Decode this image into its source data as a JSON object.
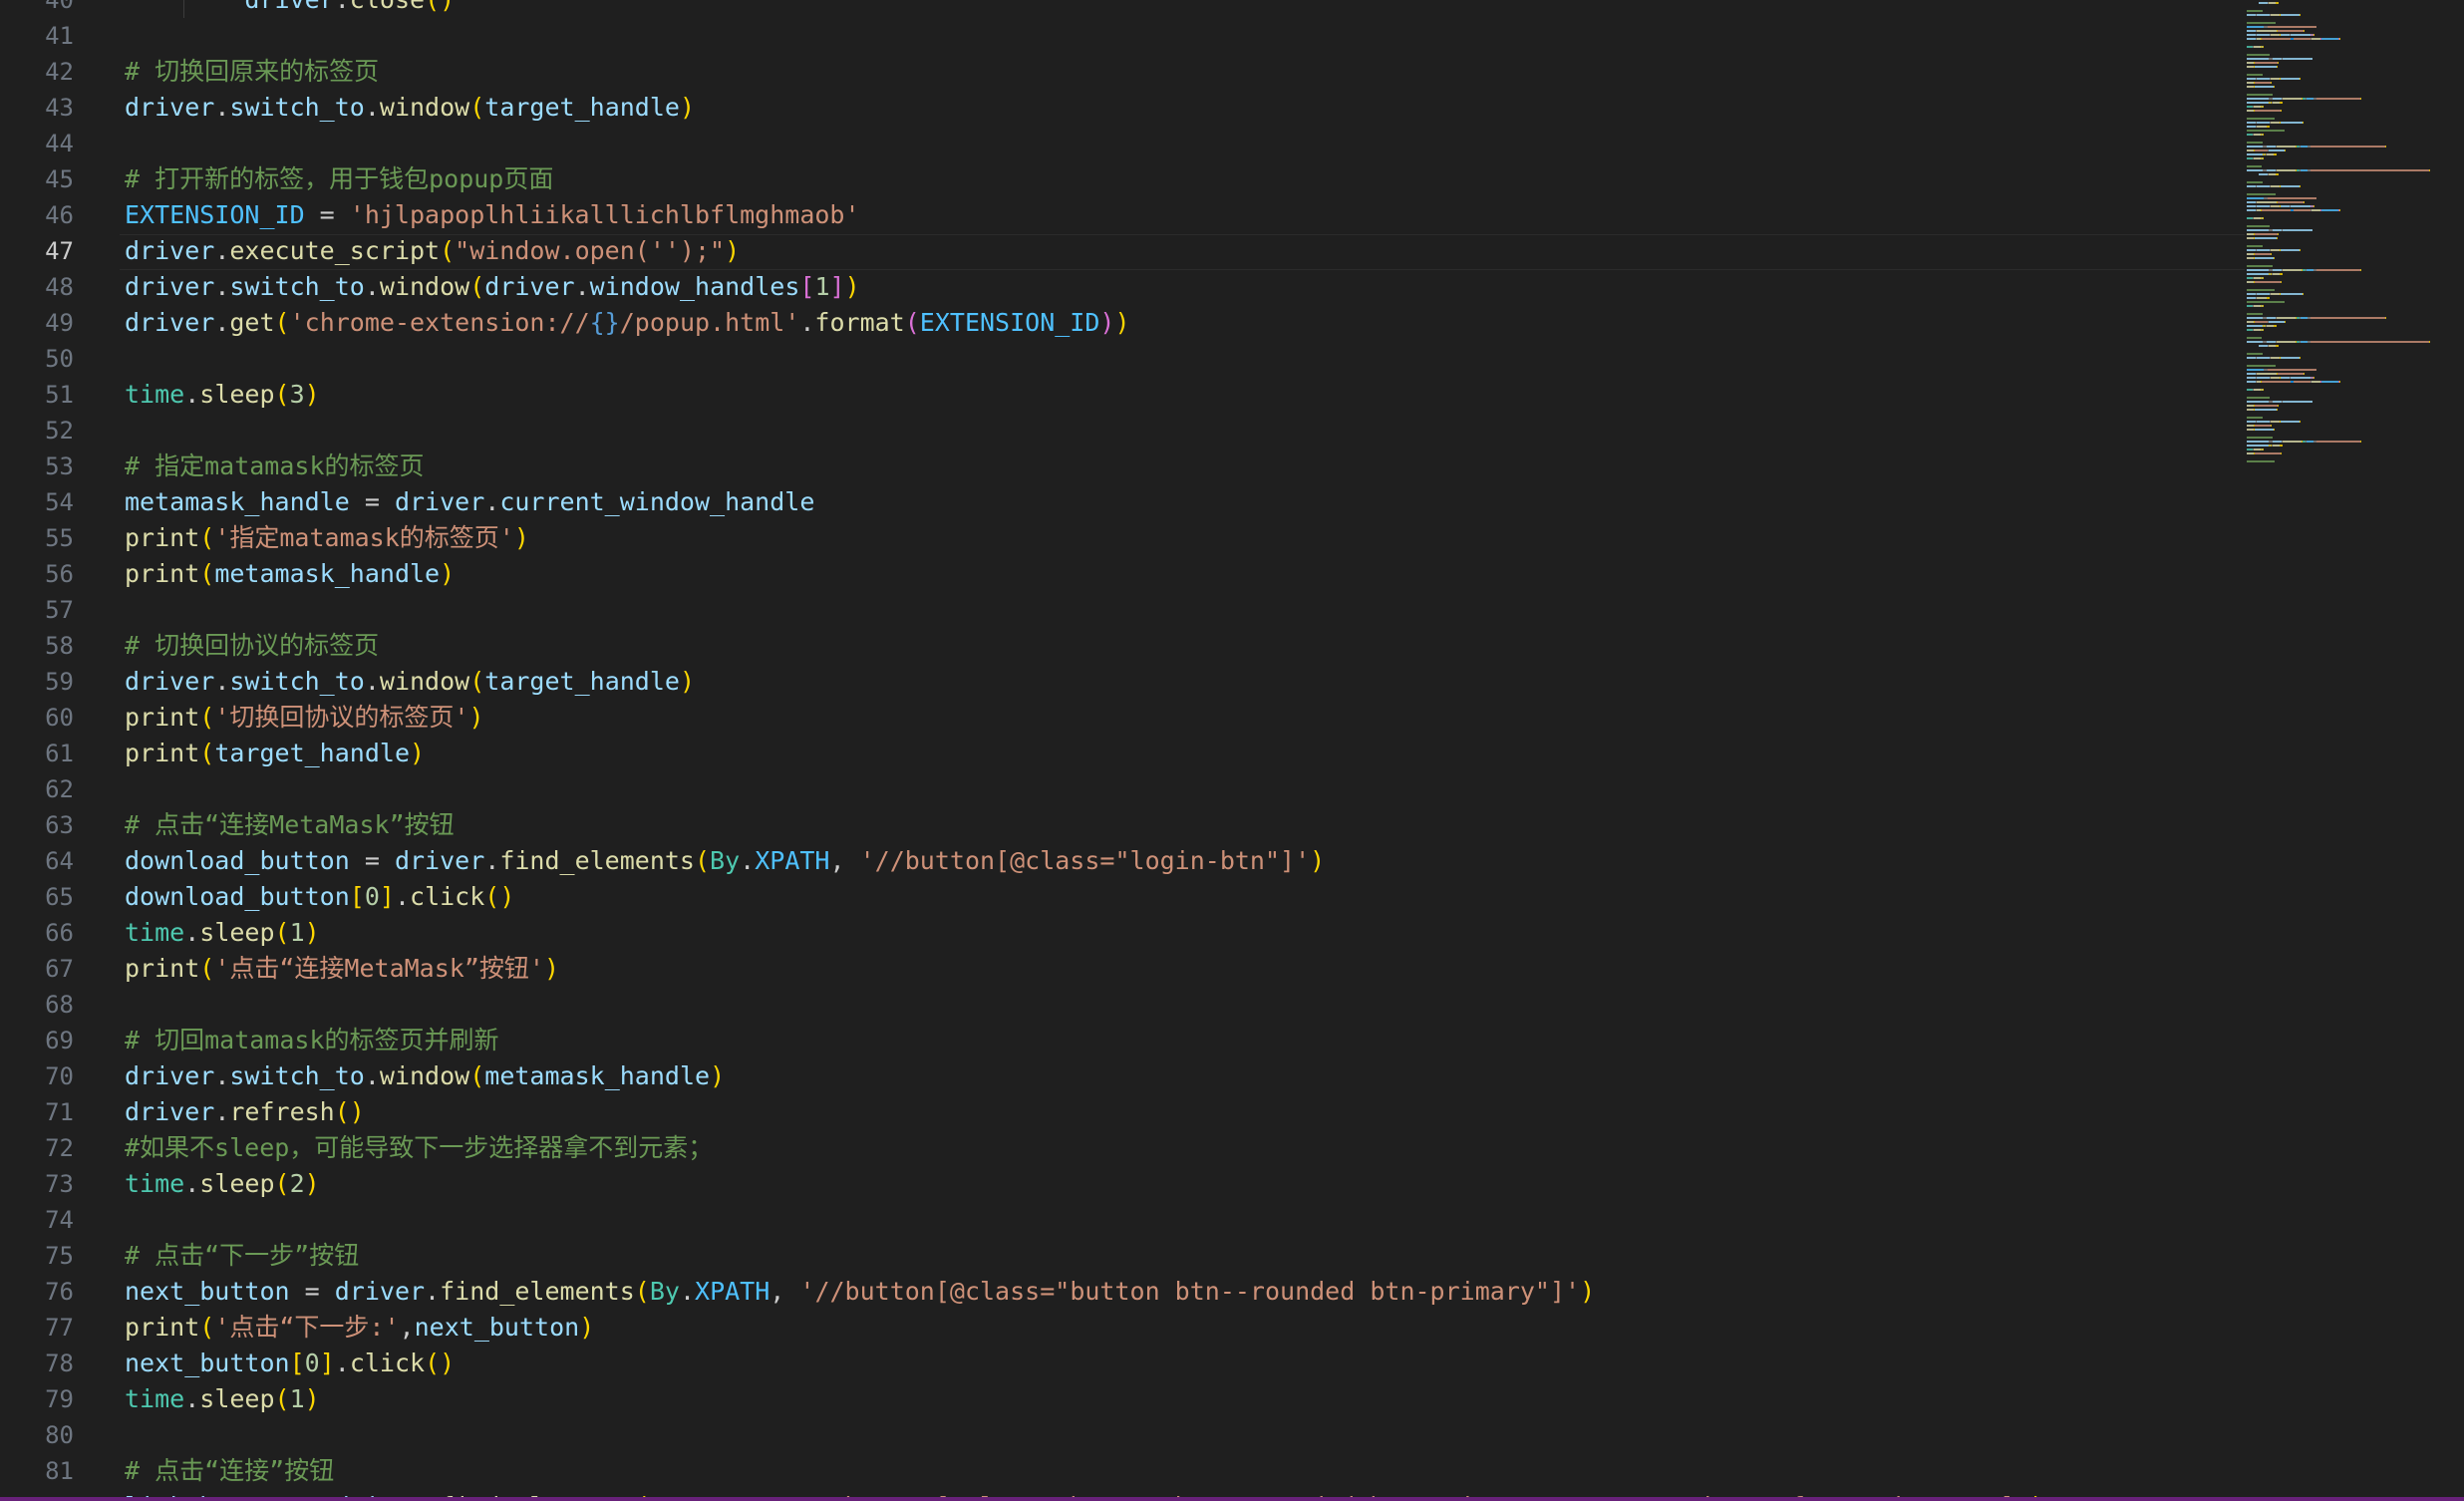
{
  "editor": {
    "active_line": "47",
    "palette": {
      "background": "#1f1f1f",
      "line_number": "#6e7681",
      "line_number_active": "#cccccc",
      "variable": "#9cdcfe",
      "function": "#dcdcaa",
      "string": "#ce9178",
      "comment": "#6a9955",
      "class": "#4ec9b0",
      "number": "#b5cea8",
      "constant": "#4fc1ff",
      "bracket_level_1": "#ffd700",
      "bracket_level_2": "#da70d6",
      "bracket_level_3": "#179fff",
      "bottom_bar": "#68217a"
    },
    "lines": [
      {
        "n": "40",
        "t": [
          [
            "p",
            "        "
          ],
          [
            "var",
            "driver"
          ],
          [
            "p",
            "."
          ],
          [
            "fn",
            "close"
          ],
          [
            "b1",
            "()"
          ]
        ]
      },
      {
        "n": "41",
        "t": []
      },
      {
        "n": "42",
        "t": [
          [
            "com",
            "# 切换回原来的标签页"
          ]
        ]
      },
      {
        "n": "43",
        "t": [
          [
            "var",
            "driver"
          ],
          [
            "p",
            "."
          ],
          [
            "var",
            "switch_to"
          ],
          [
            "p",
            "."
          ],
          [
            "fn",
            "window"
          ],
          [
            "b1",
            "("
          ],
          [
            "var",
            "target_handle"
          ],
          [
            "b1",
            ")"
          ]
        ]
      },
      {
        "n": "44",
        "t": []
      },
      {
        "n": "45",
        "t": [
          [
            "com",
            "# 打开新的标签，用于钱包popup页面"
          ]
        ]
      },
      {
        "n": "46",
        "t": [
          [
            "const",
            "EXTENSION_ID"
          ],
          [
            "p",
            " = "
          ],
          [
            "str",
            "'hjlpapoplhliikalllichlbflmghmaob'"
          ]
        ]
      },
      {
        "n": "47",
        "t": [
          [
            "var",
            "driver"
          ],
          [
            "p",
            "."
          ],
          [
            "fn",
            "execute_script"
          ],
          [
            "b1",
            "("
          ],
          [
            "str",
            "\"window.open('');\""
          ],
          [
            "b1",
            ")"
          ]
        ]
      },
      {
        "n": "48",
        "t": [
          [
            "var",
            "driver"
          ],
          [
            "p",
            "."
          ],
          [
            "var",
            "switch_to"
          ],
          [
            "p",
            "."
          ],
          [
            "fn",
            "window"
          ],
          [
            "b1",
            "("
          ],
          [
            "var",
            "driver"
          ],
          [
            "p",
            "."
          ],
          [
            "var",
            "window_handles"
          ],
          [
            "b2",
            "["
          ],
          [
            "num",
            "1"
          ],
          [
            "b2",
            "]"
          ],
          [
            "b1",
            ")"
          ]
        ]
      },
      {
        "n": "49",
        "t": [
          [
            "var",
            "driver"
          ],
          [
            "p",
            "."
          ],
          [
            "fn",
            "get"
          ],
          [
            "b1",
            "("
          ],
          [
            "str",
            "'chrome-extension://"
          ],
          [
            "esc",
            "{}"
          ],
          [
            "str",
            "/popup.html'"
          ],
          [
            "p",
            "."
          ],
          [
            "fn",
            "format"
          ],
          [
            "b2",
            "("
          ],
          [
            "const",
            "EXTENSION_ID"
          ],
          [
            "b2",
            ")"
          ],
          [
            "b1",
            ")"
          ]
        ]
      },
      {
        "n": "50",
        "t": []
      },
      {
        "n": "51",
        "t": [
          [
            "cls",
            "time"
          ],
          [
            "p",
            "."
          ],
          [
            "fn",
            "sleep"
          ],
          [
            "b1",
            "("
          ],
          [
            "num",
            "3"
          ],
          [
            "b1",
            ")"
          ]
        ]
      },
      {
        "n": "52",
        "t": []
      },
      {
        "n": "53",
        "t": [
          [
            "com",
            "# 指定matamask的标签页"
          ]
        ]
      },
      {
        "n": "54",
        "t": [
          [
            "var",
            "metamask_handle"
          ],
          [
            "p",
            " = "
          ],
          [
            "var",
            "driver"
          ],
          [
            "p",
            "."
          ],
          [
            "var",
            "current_window_handle"
          ]
        ]
      },
      {
        "n": "55",
        "t": [
          [
            "fn",
            "print"
          ],
          [
            "b1",
            "("
          ],
          [
            "str",
            "'指定matamask的标签页'"
          ],
          [
            "b1",
            ")"
          ]
        ]
      },
      {
        "n": "56",
        "t": [
          [
            "fn",
            "print"
          ],
          [
            "b1",
            "("
          ],
          [
            "var",
            "metamask_handle"
          ],
          [
            "b1",
            ")"
          ]
        ]
      },
      {
        "n": "57",
        "t": []
      },
      {
        "n": "58",
        "t": [
          [
            "com",
            "# 切换回协议的标签页"
          ]
        ]
      },
      {
        "n": "59",
        "t": [
          [
            "var",
            "driver"
          ],
          [
            "p",
            "."
          ],
          [
            "var",
            "switch_to"
          ],
          [
            "p",
            "."
          ],
          [
            "fn",
            "window"
          ],
          [
            "b1",
            "("
          ],
          [
            "var",
            "target_handle"
          ],
          [
            "b1",
            ")"
          ]
        ]
      },
      {
        "n": "60",
        "t": [
          [
            "fn",
            "print"
          ],
          [
            "b1",
            "("
          ],
          [
            "str",
            "'切换回协议的标签页'"
          ],
          [
            "b1",
            ")"
          ]
        ]
      },
      {
        "n": "61",
        "t": [
          [
            "fn",
            "print"
          ],
          [
            "b1",
            "("
          ],
          [
            "var",
            "target_handle"
          ],
          [
            "b1",
            ")"
          ]
        ]
      },
      {
        "n": "62",
        "t": []
      },
      {
        "n": "63",
        "t": [
          [
            "com",
            "# 点击“连接MetaMask”按钮"
          ]
        ]
      },
      {
        "n": "64",
        "t": [
          [
            "var",
            "download_button"
          ],
          [
            "p",
            " = "
          ],
          [
            "var",
            "driver"
          ],
          [
            "p",
            "."
          ],
          [
            "fn",
            "find_elements"
          ],
          [
            "b1",
            "("
          ],
          [
            "cls",
            "By"
          ],
          [
            "p",
            "."
          ],
          [
            "const",
            "XPATH"
          ],
          [
            "p",
            ", "
          ],
          [
            "str",
            "'//button[@class=\"login-btn\"]'"
          ],
          [
            "b1",
            ")"
          ]
        ]
      },
      {
        "n": "65",
        "t": [
          [
            "var",
            "download_button"
          ],
          [
            "b1",
            "["
          ],
          [
            "num",
            "0"
          ],
          [
            "b1",
            "]"
          ],
          [
            "p",
            "."
          ],
          [
            "fn",
            "click"
          ],
          [
            "b1",
            "()"
          ]
        ]
      },
      {
        "n": "66",
        "t": [
          [
            "cls",
            "time"
          ],
          [
            "p",
            "."
          ],
          [
            "fn",
            "sleep"
          ],
          [
            "b1",
            "("
          ],
          [
            "num",
            "1"
          ],
          [
            "b1",
            ")"
          ]
        ]
      },
      {
        "n": "67",
        "t": [
          [
            "fn",
            "print"
          ],
          [
            "b1",
            "("
          ],
          [
            "str",
            "'点击“连接MetaMask”按钮'"
          ],
          [
            "b1",
            ")"
          ]
        ]
      },
      {
        "n": "68",
        "t": []
      },
      {
        "n": "69",
        "t": [
          [
            "com",
            "# 切回matamask的标签页并刷新"
          ]
        ]
      },
      {
        "n": "70",
        "t": [
          [
            "var",
            "driver"
          ],
          [
            "p",
            "."
          ],
          [
            "var",
            "switch_to"
          ],
          [
            "p",
            "."
          ],
          [
            "fn",
            "window"
          ],
          [
            "b1",
            "("
          ],
          [
            "var",
            "metamask_handle"
          ],
          [
            "b1",
            ")"
          ]
        ]
      },
      {
        "n": "71",
        "t": [
          [
            "var",
            "driver"
          ],
          [
            "p",
            "."
          ],
          [
            "fn",
            "refresh"
          ],
          [
            "b1",
            "()"
          ]
        ]
      },
      {
        "n": "72",
        "t": [
          [
            "com",
            "#如果不sleep，可能导致下一步选择器拿不到元素；"
          ]
        ]
      },
      {
        "n": "73",
        "t": [
          [
            "cls",
            "time"
          ],
          [
            "p",
            "."
          ],
          [
            "fn",
            "sleep"
          ],
          [
            "b1",
            "("
          ],
          [
            "num",
            "2"
          ],
          [
            "b1",
            ")"
          ]
        ]
      },
      {
        "n": "74",
        "t": []
      },
      {
        "n": "75",
        "t": [
          [
            "com",
            "# 点击“下一步”按钮"
          ]
        ]
      },
      {
        "n": "76",
        "t": [
          [
            "var",
            "next_button"
          ],
          [
            "p",
            " = "
          ],
          [
            "var",
            "driver"
          ],
          [
            "p",
            "."
          ],
          [
            "fn",
            "find_elements"
          ],
          [
            "b1",
            "("
          ],
          [
            "cls",
            "By"
          ],
          [
            "p",
            "."
          ],
          [
            "const",
            "XPATH"
          ],
          [
            "p",
            ", "
          ],
          [
            "str",
            "'//button[@class=\"button btn--rounded btn-primary\"]'"
          ],
          [
            "b1",
            ")"
          ]
        ]
      },
      {
        "n": "77",
        "t": [
          [
            "fn",
            "print"
          ],
          [
            "b1",
            "("
          ],
          [
            "str",
            "'点击“下一步:'"
          ],
          [
            "p",
            ","
          ],
          [
            "var",
            "next_button"
          ],
          [
            "b1",
            ")"
          ]
        ]
      },
      {
        "n": "78",
        "t": [
          [
            "var",
            "next_button"
          ],
          [
            "b1",
            "["
          ],
          [
            "num",
            "0"
          ],
          [
            "b1",
            "]"
          ],
          [
            "p",
            "."
          ],
          [
            "fn",
            "click"
          ],
          [
            "b1",
            "()"
          ]
        ]
      },
      {
        "n": "79",
        "t": [
          [
            "cls",
            "time"
          ],
          [
            "p",
            "."
          ],
          [
            "fn",
            "sleep"
          ],
          [
            "b1",
            "("
          ],
          [
            "num",
            "1"
          ],
          [
            "b1",
            ")"
          ]
        ]
      },
      {
        "n": "80",
        "t": []
      },
      {
        "n": "81",
        "t": [
          [
            "com",
            "# 点击“连接”按钮"
          ]
        ]
      },
      {
        "n": "82",
        "t": [
          [
            "var",
            "link_button"
          ],
          [
            "p",
            " = "
          ],
          [
            "var",
            "driver"
          ],
          [
            "p",
            "."
          ],
          [
            "fn",
            "find_elements"
          ],
          [
            "b1",
            "("
          ],
          [
            "cls",
            "By"
          ],
          [
            "p",
            "."
          ],
          [
            "const",
            "XPATH"
          ],
          [
            "p",
            ", "
          ],
          [
            "str",
            "'//button[@class=\"button btn--rounded btn-primary page-container__footer-button\"]'"
          ],
          [
            "b1",
            ")"
          ]
        ]
      }
    ]
  }
}
